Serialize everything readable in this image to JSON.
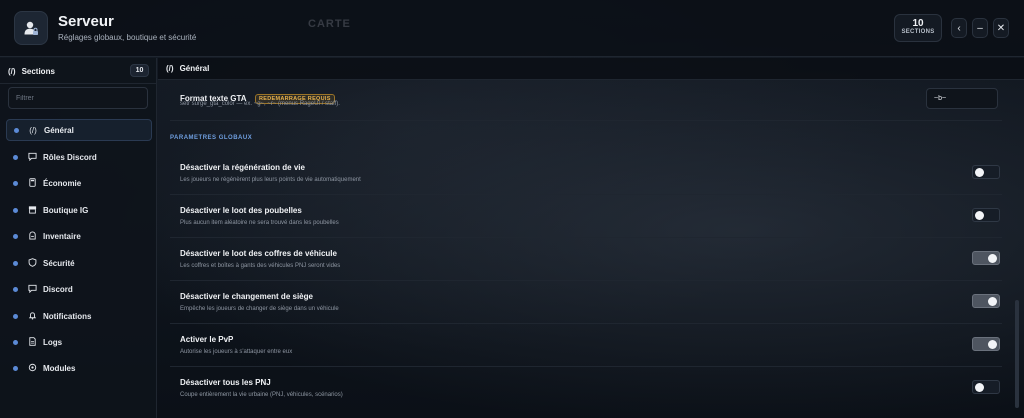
{
  "header": {
    "title": "Serveur",
    "subtitle": "Réglages globaux, boutique et sécurité",
    "watermark": "CARTE",
    "sections_count": "10",
    "sections_label": "SECTIONS",
    "icons": {
      "app": "admin-user-lock-icon",
      "back": "chevron-left-icon",
      "minimize": "minus-icon",
      "close": "close-icon"
    }
  },
  "sidebar": {
    "title": "Sections",
    "count": "10",
    "filter_placeholder": "Filtrer",
    "items": [
      {
        "label": "Général",
        "icon": "braces-icon",
        "active": true
      },
      {
        "label": "Rôles Discord",
        "icon": "chat-bubble-icon",
        "active": false
      },
      {
        "label": "Économie",
        "icon": "calculator-icon",
        "active": false
      },
      {
        "label": "Boutique IG",
        "icon": "shop-icon",
        "active": false
      },
      {
        "label": "Inventaire",
        "icon": "backpack-icon",
        "active": false
      },
      {
        "label": "Sécurité",
        "icon": "shield-icon",
        "active": false
      },
      {
        "label": "Discord",
        "icon": "chat-icon",
        "active": false
      },
      {
        "label": "Notifications",
        "icon": "bell-icon",
        "active": false
      },
      {
        "label": "Logs",
        "icon": "document-icon",
        "active": false
      },
      {
        "label": "Modules",
        "icon": "modules-icon",
        "active": false
      }
    ]
  },
  "main": {
    "title": "Général",
    "format_row": {
      "label": "Format texte GTA",
      "badge": "REDEMARRAGE REQUIS",
      "description": "setr surge_gta_color — ex. ~g~, ~r~ (menus RageUI / staff).",
      "value": "~b~"
    },
    "section_label": "PARAMETRES GLOBAUX",
    "settings": [
      {
        "title": "Désactiver la régénération de vie",
        "description": "Les joueurs ne régénèrent plus leurs points de vie automatiquement",
        "enabled": false
      },
      {
        "title": "Désactiver le loot des poubelles",
        "description": "Plus aucun item aléatoire ne sera trouvé dans les poubelles",
        "enabled": false
      },
      {
        "title": "Désactiver le loot des coffres de véhicule",
        "description": "Les coffres et boîtes à gants des véhicules PNJ seront vides",
        "enabled": true
      },
      {
        "title": "Désactiver le changement de siège",
        "description": "Empêche les joueurs de changer de siège dans un véhicule",
        "enabled": true
      },
      {
        "title": "Activer le PvP",
        "description": "Autorise les joueurs à s'attaquer entre eux",
        "enabled": true
      },
      {
        "title": "Désactiver tous les PNJ",
        "description": "Coupe entièrement la vie urbaine (PNJ, véhicules, scénarios)",
        "enabled": false
      }
    ]
  },
  "colors": {
    "accent": "#5b8ad6",
    "badge": "#e6b04a",
    "background": "#0c1119"
  }
}
